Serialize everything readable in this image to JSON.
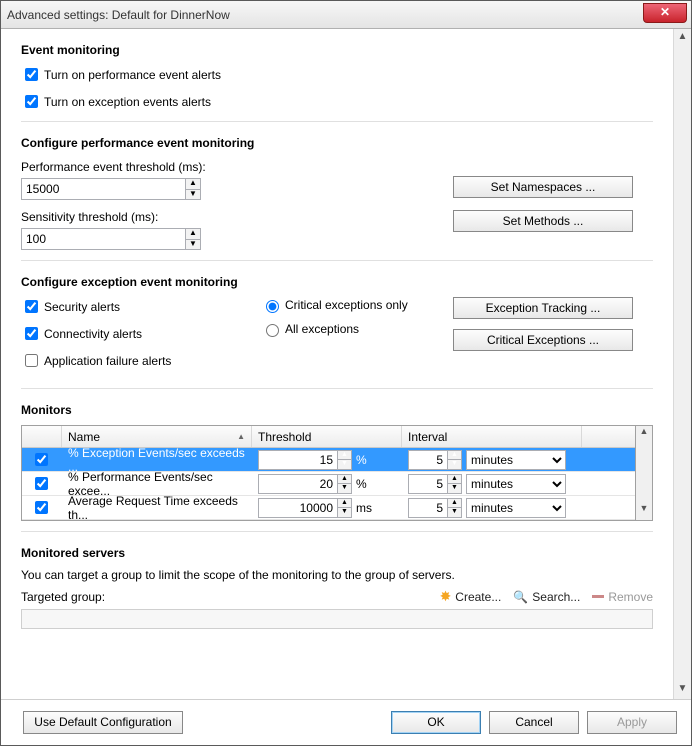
{
  "title": "Advanced settings: Default for DinnerNow",
  "event_monitoring": {
    "header": "Event monitoring",
    "perf_alerts": {
      "checked": true,
      "label": "Turn on performance event alerts"
    },
    "exc_alerts": {
      "checked": true,
      "label": "Turn on exception events alerts"
    }
  },
  "config_perf": {
    "header": "Configure performance event monitoring",
    "threshold_label": "Performance event threshold (ms):",
    "threshold_value": "15000",
    "sensitivity_label": "Sensitivity threshold (ms):",
    "sensitivity_value": "100",
    "btn_namespaces": "Set Namespaces ...",
    "btn_methods": "Set Methods ..."
  },
  "config_exc": {
    "header": "Configure exception event monitoring",
    "security": {
      "checked": true,
      "label": "Security alerts"
    },
    "connectivity": {
      "checked": true,
      "label": "Connectivity alerts"
    },
    "appfailure": {
      "checked": false,
      "label": "Application failure alerts"
    },
    "opt_critical": {
      "selected": true,
      "label": "Critical exceptions only"
    },
    "opt_all": {
      "selected": false,
      "label": "All exceptions"
    },
    "btn_tracking": "Exception Tracking ...",
    "btn_critical": "Critical Exceptions ..."
  },
  "monitors": {
    "header": "Monitors",
    "cols": {
      "name": "Name",
      "threshold": "Threshold",
      "interval": "Interval"
    },
    "rows": [
      {
        "checked": true,
        "selected": true,
        "name": "% Exception Events/sec exceeds ...",
        "threshold": "15",
        "unit": "%",
        "interval": "5",
        "interval_unit": "minutes"
      },
      {
        "checked": true,
        "selected": false,
        "name": "% Performance Events/sec excee...",
        "threshold": "20",
        "unit": "%",
        "interval": "5",
        "interval_unit": "minutes"
      },
      {
        "checked": true,
        "selected": false,
        "name": "Average Request Time exceeds th...",
        "threshold": "10000",
        "unit": "ms",
        "interval": "5",
        "interval_unit": "minutes"
      }
    ]
  },
  "servers": {
    "header": "Monitored servers",
    "desc": "You can target a group to limit the scope of the monitoring to the group of servers.",
    "targeted_label": "Targeted group:",
    "create": "Create...",
    "search": "Search...",
    "remove": "Remove"
  },
  "footer": {
    "use_default": "Use Default Configuration",
    "ok": "OK",
    "cancel": "Cancel",
    "apply": "Apply"
  }
}
